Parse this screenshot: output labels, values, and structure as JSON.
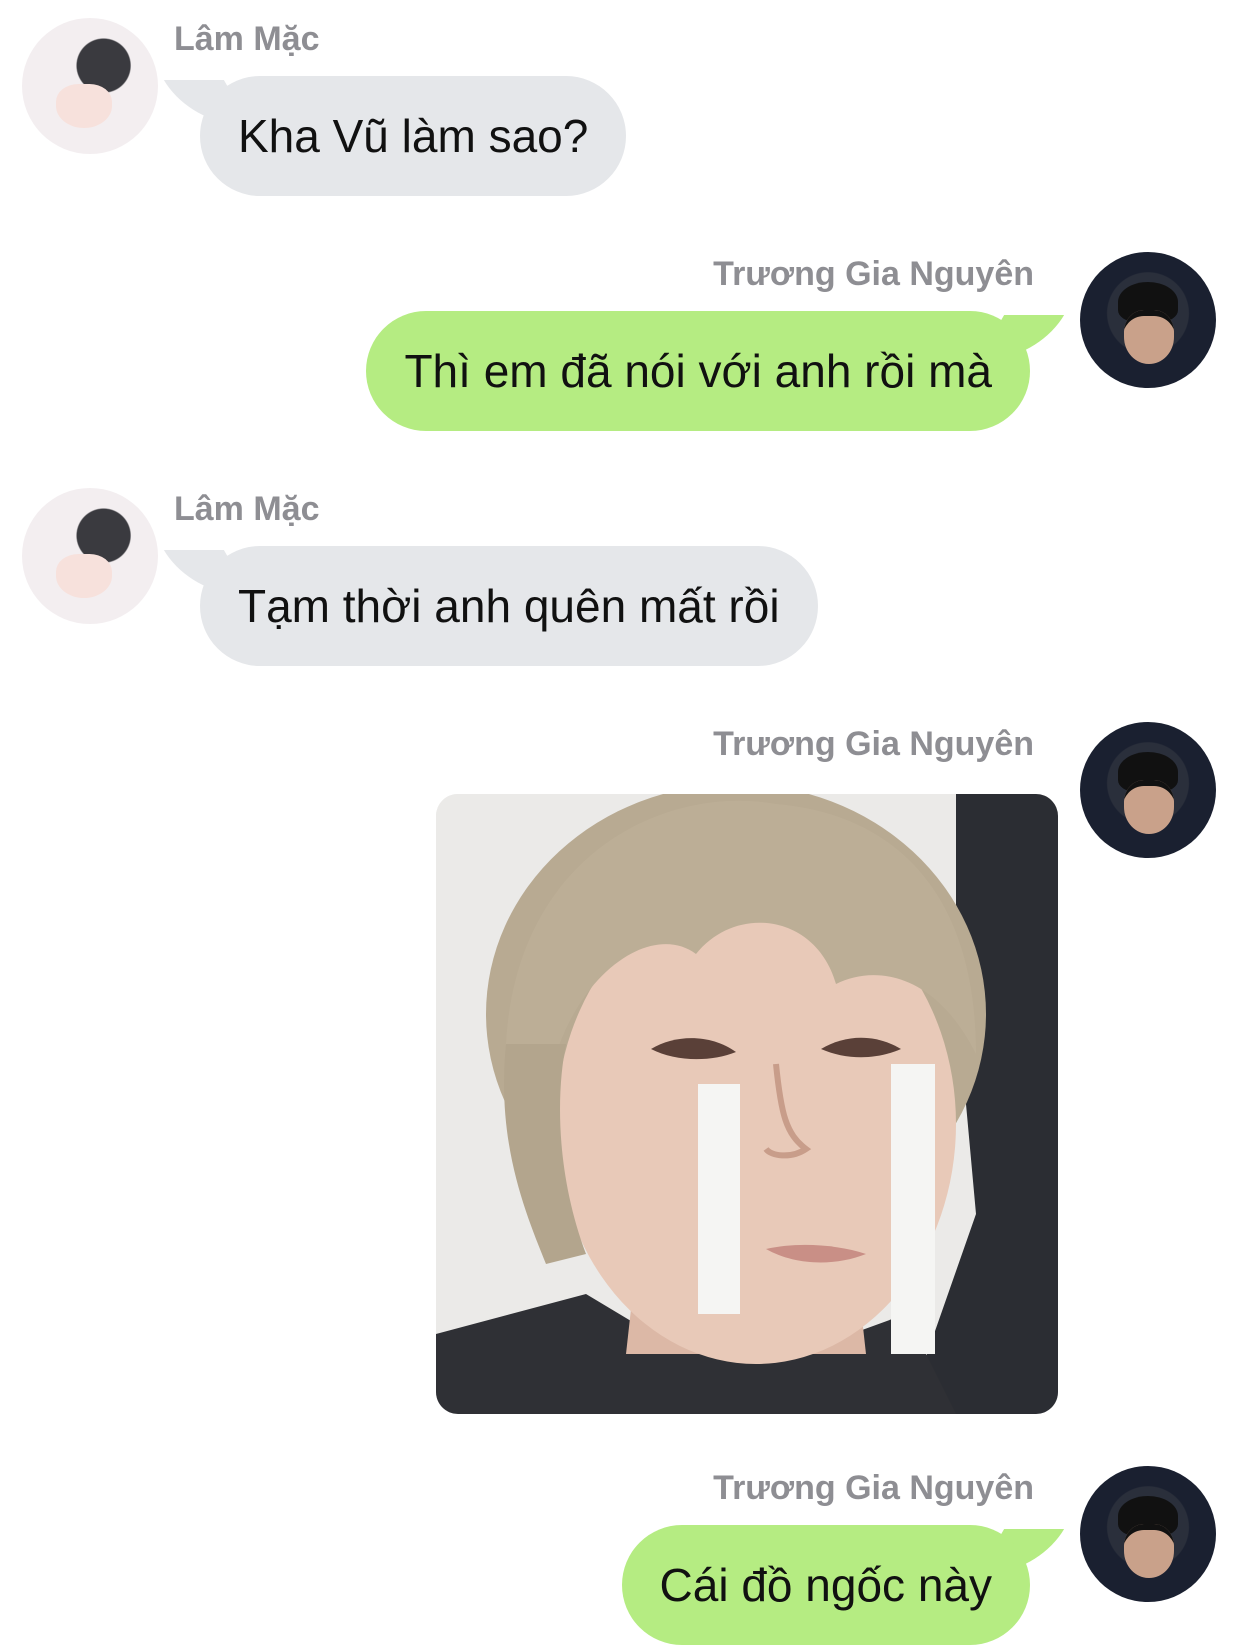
{
  "messages": [
    {
      "sender": "Lâm Mặc",
      "side": "left",
      "text": "Kha Vũ làm sao?"
    },
    {
      "sender": "Trương Gia Nguyên",
      "side": "right",
      "text": "Thì em đã nói với anh rồi mà"
    },
    {
      "sender": "Lâm Mặc",
      "side": "left",
      "text": "Tạm thời anh quên mất rồi"
    },
    {
      "sender": "Trương Gia Nguyên",
      "side": "right",
      "type": "image",
      "text": ""
    },
    {
      "sender": "Trương Gia Nguyên",
      "side": "right",
      "text": "Cái đồ ngốc này"
    }
  ],
  "colors": {
    "incoming_bubble": "#e5e7ea",
    "outgoing_bubble": "#b5ec82",
    "sender_name": "#8e8e93",
    "background": "#ffffff"
  }
}
